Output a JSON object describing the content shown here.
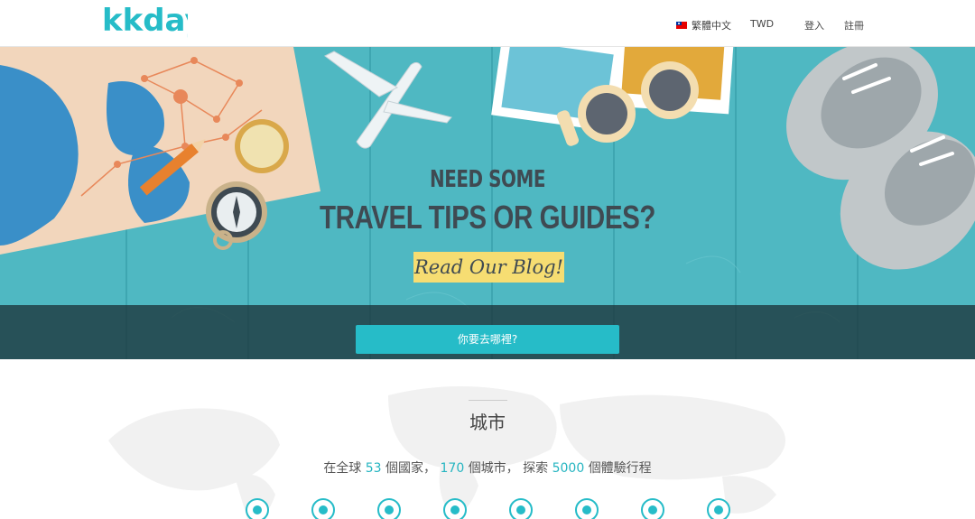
{
  "header": {
    "logo_text": "kkday",
    "language": "繁體中文",
    "currency": "TWD",
    "login": "登入",
    "register": "註冊"
  },
  "hero": {
    "title_line1": "NEED SOME",
    "title_line2": "TRAVEL TIPS OR GUIDES?",
    "blog_button": "Read Our Blog!",
    "search_button": "你要去哪裡?"
  },
  "cities": {
    "title": "城市",
    "stats": {
      "prefix": "在全球",
      "countries": "53",
      "countries_unit": "個國家，",
      "cities": "170",
      "cities_unit": "個城市，",
      "explore": "探索",
      "experiences": "5000",
      "experiences_unit": "個體驗行程"
    },
    "city_markers": 8
  },
  "colors": {
    "brand": "#26bcc8",
    "hero_bg": "#4fb8c2",
    "blog_button_bg": "#f6dd72",
    "title_text": "#3f4a52"
  }
}
